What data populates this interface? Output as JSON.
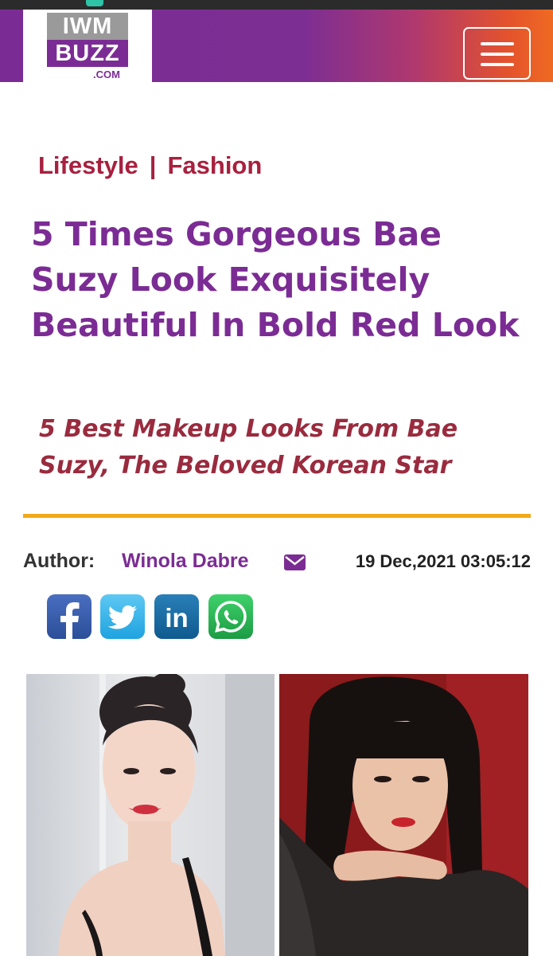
{
  "site": {
    "logo_top": "IWM",
    "logo_bottom": "BUZZ",
    "logo_suffix": ".COM"
  },
  "nav": {
    "menu_icon": "hamburger-menu-icon"
  },
  "article": {
    "categories": [
      "Lifestyle",
      "Fashion"
    ],
    "category_separator": "|",
    "title": "5 Times Gorgeous Bae Suzy Look Exquisitely Beautiful In Bold Red Look",
    "subtitle": "5 Best Makeup Looks From Bae Suzy, The Beloved Korean Star",
    "author_label": "Author:",
    "author_name": "Winola Dabre",
    "date": "19 Dec,2021 03:05:12"
  },
  "share": {
    "facebook": "f",
    "linkedin": "in"
  },
  "colors": {
    "brand_purple": "#7b2c94",
    "brand_orange": "#ef6a22",
    "category_red": "#a8203f",
    "divider_gold": "#f2a91a"
  }
}
